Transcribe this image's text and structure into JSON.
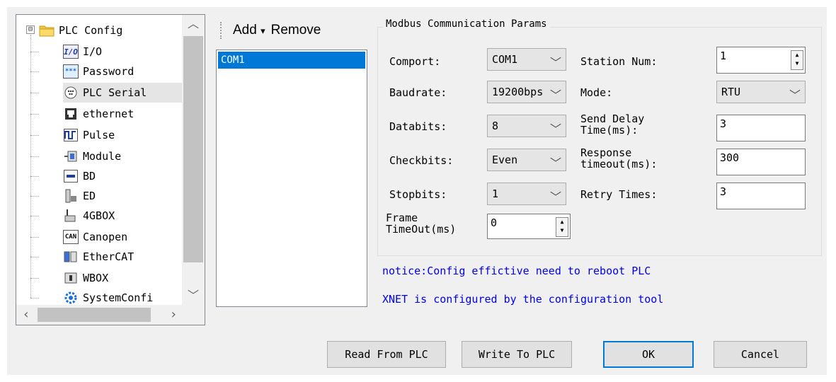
{
  "tree": {
    "items": [
      {
        "label": "PLC Config",
        "icon": "folder-icon"
      },
      {
        "label": "I/O",
        "icon": "io-icon"
      },
      {
        "label": "Password",
        "icon": "password-icon"
      },
      {
        "label": "PLC Serial",
        "icon": "serial-port-icon"
      },
      {
        "label": "ethernet",
        "icon": "ethernet-icon"
      },
      {
        "label": "Pulse",
        "icon": "pulse-icon"
      },
      {
        "label": "Module",
        "icon": "module-icon"
      },
      {
        "label": "BD",
        "icon": "bd-icon"
      },
      {
        "label": "ED",
        "icon": "ed-icon"
      },
      {
        "label": "4GBOX",
        "icon": "4gbox-icon"
      },
      {
        "label": "Canopen",
        "icon": "canopen-icon"
      },
      {
        "label": "EtherCAT",
        "icon": "ethercat-icon"
      },
      {
        "label": "WBOX",
        "icon": "wbox-icon"
      },
      {
        "label": "SystemConfi",
        "icon": "gear-icon"
      }
    ],
    "selected": "PLC Serial",
    "expander": "⊟"
  },
  "com_toolbar": {
    "add_label": "Add",
    "add_arrow": "▾",
    "remove_label": "Remove"
  },
  "com_list": {
    "items": [
      "COM1"
    ],
    "selected": "COM1"
  },
  "group": {
    "title": "Modbus Communication Params",
    "comport": {
      "label": "Comport:",
      "value": "COM1"
    },
    "baudrate": {
      "label": "Baudrate:",
      "value": "19200bps"
    },
    "databits": {
      "label": "Databits:",
      "value": "8"
    },
    "checkbits": {
      "label": "Checkbits:",
      "value": "Even"
    },
    "stopbits": {
      "label": "Stopbits:",
      "value": "1"
    },
    "frame_timeout": {
      "label_line1": "Frame",
      "label_line2": "TimeOut(ms)",
      "value": "0"
    },
    "station_num": {
      "label": "Station Num:",
      "value": "1"
    },
    "mode": {
      "label": "Mode:",
      "value": "RTU"
    },
    "send_delay": {
      "label_line1": "Send Delay",
      "label_line2": "Time(ms):",
      "value": "3"
    },
    "response_timeout": {
      "label_line1": "Response",
      "label_line2": "timeout(ms):",
      "value": "300"
    },
    "retry_times": {
      "label": "Retry Times:",
      "value": "3"
    }
  },
  "notices": [
    "notice:Config effictive need to reboot PLC",
    "XNET is configured by the configuration tool"
  ],
  "buttons": {
    "read": "Read From PLC",
    "write": "Write To PLC",
    "ok": "OK",
    "cancel": "Cancel"
  },
  "colors": {
    "selection": "#0078d7",
    "notice": "#0000ee",
    "default_button_border": "#0078d7"
  }
}
